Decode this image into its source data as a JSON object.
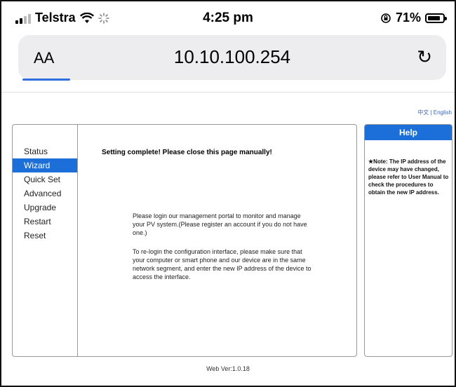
{
  "status_bar": {
    "carrier": "Telstra",
    "time": "4:25 pm",
    "battery": "71%"
  },
  "browser": {
    "text_size_label": "AA",
    "url": "10.10.100.254",
    "reload_glyph": "↻"
  },
  "language_switch": {
    "chinese": "中文",
    "separator": " | ",
    "english": "English"
  },
  "nav": {
    "items": [
      {
        "label": "Status"
      },
      {
        "label": "Wizard"
      },
      {
        "label": "Quick Set"
      },
      {
        "label": "Advanced"
      },
      {
        "label": "Upgrade"
      },
      {
        "label": "Restart"
      },
      {
        "label": "Reset"
      }
    ],
    "active": "Wizard"
  },
  "content": {
    "headline": "Setting complete! Please close this page manually!",
    "paragraph1": "Please login our management portal to monitor and manage your PV system.(Please register an account if you do not have one.)",
    "paragraph2": "To re-login the configuration interface, please make sure that your computer or smart phone and our device are in the same network segment, and enter the new IP address of the device to access the interface."
  },
  "help": {
    "title": "Help",
    "note": "★Note: The IP address of the device may have changed, please refer to User Manual to check the procedures to obtain the new IP address."
  },
  "footer": {
    "version": "Web Ver:1.0.18"
  },
  "colors": {
    "accent": "#1c6fd8",
    "url_underline": "#2f6fde",
    "url_bar_bg": "#ededf0"
  }
}
